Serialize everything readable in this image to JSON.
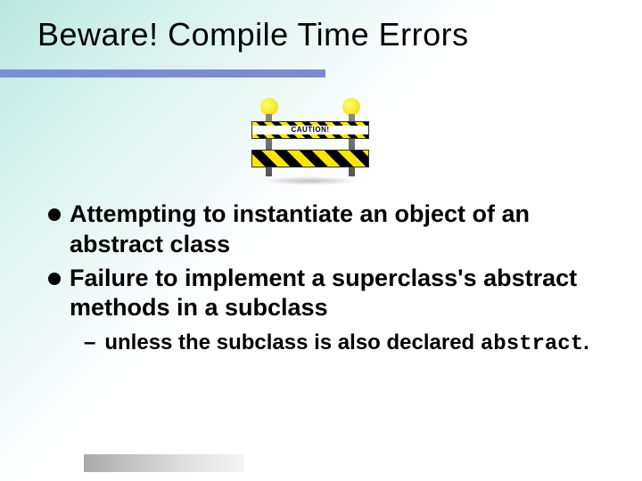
{
  "title": "Beware!  Compile Time Errors",
  "caution_label": "CAUTION!",
  "bullets": [
    "Attempting to instantiate an object of an abstract class",
    "Failure to implement a superclass's abstract methods in a subclass"
  ],
  "sub_prefix": "unless the subclass is also declared ",
  "sub_code": "abstract",
  "sub_suffix": "."
}
